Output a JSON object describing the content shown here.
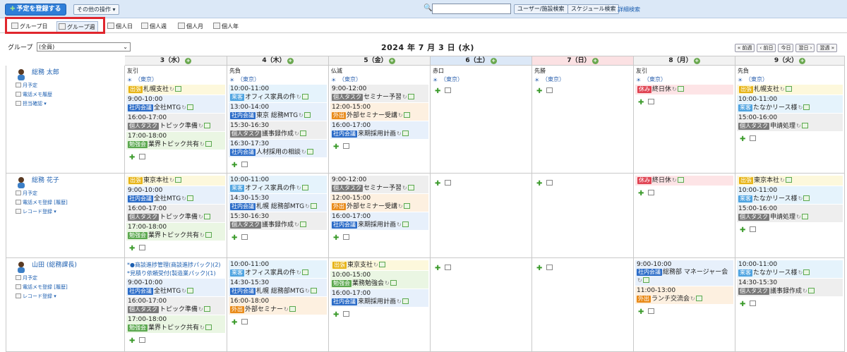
{
  "toolbar": {
    "register_label": "予定を登録する",
    "other_label": "その他の操作 ▾",
    "user_search": "ユーザー/施設検索",
    "schedule_search": "スケジュール検索",
    "detail_search": "詳細検索",
    "search_placeholder": ""
  },
  "tabs": [
    {
      "label": "グループ日"
    },
    {
      "label": "グループ週"
    },
    {
      "label": "個人日"
    },
    {
      "label": "個人週"
    },
    {
      "label": "個人月"
    },
    {
      "label": "個人年"
    }
  ],
  "group": {
    "label": "グループ",
    "selected": "(全員)"
  },
  "date_title": "2024 年 7 月 3 日 (水)",
  "nav": {
    "prev_week": "« 前週",
    "prev_day": "‹ 前日",
    "today": "今日",
    "next_day": "翌日 ›",
    "next_week": "翌週 »"
  },
  "days": [
    {
      "label": "3（水）",
      "rokuyo": "友引",
      "weather": "（東京）"
    },
    {
      "label": "4（木）",
      "rokuyo": "先負",
      "weather": "（東京）"
    },
    {
      "label": "5（金）",
      "rokuyo": "仏滅",
      "weather": "（東京）"
    },
    {
      "label": "6（土）",
      "rokuyo": "赤口",
      "weather": "（東京）"
    },
    {
      "label": "7（日）",
      "rokuyo": "先勝",
      "weather": "（東京）"
    },
    {
      "label": "8（月）",
      "rokuyo": "友引",
      "weather": "（東京）"
    },
    {
      "label": "9（火）",
      "rokuyo": "先負",
      "weather": "（東京）"
    }
  ],
  "users": [
    {
      "name": "総務 太郎",
      "links": [
        "月予定",
        "電話メモ履歴",
        "担当確認 ▾"
      ],
      "days": [
        [
          {
            "c": "yellow",
            "tag": "出張",
            "title": "札幌支社",
            "allday": true
          },
          {
            "c": "blue",
            "time": "9:00-10:00",
            "tag": "社内会議",
            "title": "全社MTG"
          },
          {
            "c": "gray",
            "time": "16:00-17:00",
            "tag": "個人タスク",
            "title": "トピック準備"
          },
          {
            "c": "green",
            "time": "17:00-18:00",
            "tag": "勉強会",
            "title": "業界トピック共有"
          }
        ],
        [
          {
            "c": "lblue",
            "time": "10:00-11:00",
            "tag": "来客",
            "title": "オフィス家具の件"
          },
          {
            "c": "blue",
            "time": "13:00-14:00",
            "tag": "社内会議",
            "title": "東京 総務MTG"
          },
          {
            "c": "gray",
            "time": "15:30-16:30",
            "tag": "個人タスク",
            "title": "議事録作成"
          },
          {
            "c": "blue",
            "time": "16:30-17:30",
            "tag": "社内会議",
            "title": "人材採用の相談"
          }
        ],
        [
          {
            "c": "gray",
            "time": "9:00-12:00",
            "tag": "個人タスク",
            "title": "セミナー予習"
          },
          {
            "c": "orange",
            "time": "12:00-15:00",
            "tag": "外出",
            "title": "外部セミナー受講"
          },
          {
            "c": "blue",
            "time": "16:00-17:00",
            "tag": "社内会議",
            "title": "来期採用計画"
          }
        ],
        [],
        [],
        [
          {
            "c": "red",
            "tag": "休み",
            "title": "終日休",
            "allday": true
          }
        ],
        [
          {
            "c": "yellow",
            "tag": "出張",
            "title": "札幌支社",
            "allday": true
          },
          {
            "c": "lblue",
            "time": "10:00-11:00",
            "tag": "来客",
            "title": "たなかリース様"
          },
          {
            "c": "gray",
            "time": "15:00-16:00",
            "tag": "個人タスク",
            "title": "申請処理"
          }
        ]
      ]
    },
    {
      "name": "総務 花子",
      "links": [
        "月予定",
        "電話メモ登録 [履歴]",
        "レコード登録 ▾"
      ],
      "days": [
        [
          {
            "c": "yellow",
            "tag": "出張",
            "title": "東京本社",
            "allday": true
          },
          {
            "c": "blue",
            "time": "9:00-10:00",
            "tag": "社内会議",
            "title": "全社MTG"
          },
          {
            "c": "gray",
            "time": "16:00-17:00",
            "tag": "個人タスク",
            "title": "トピック準備"
          },
          {
            "c": "green",
            "time": "17:00-18:00",
            "tag": "勉強会",
            "title": "業界トピック共有"
          }
        ],
        [
          {
            "c": "lblue",
            "time": "10:00-11:00",
            "tag": "来客",
            "title": "オフィス家具の件"
          },
          {
            "c": "blue",
            "time": "14:30-15:30",
            "tag": "社内会議",
            "title": "札幌 総務部MTG"
          },
          {
            "c": "gray",
            "time": "15:30-16:30",
            "tag": "個人タスク",
            "title": "議事録作成"
          }
        ],
        [
          {
            "c": "gray",
            "time": "9:00-12:00",
            "tag": "個人タスク",
            "title": "セミナー予習"
          },
          {
            "c": "orange",
            "time": "12:00-15:00",
            "tag": "外出",
            "title": "外部セミナー受講"
          },
          {
            "c": "blue",
            "time": "16:00-17:00",
            "tag": "社内会議",
            "title": "来期採用計画"
          }
        ],
        [],
        [],
        [
          {
            "c": "red",
            "tag": "休み",
            "title": "終日休",
            "allday": true
          }
        ],
        [
          {
            "c": "yellow",
            "tag": "出張",
            "title": "東京本社",
            "allday": true
          },
          {
            "c": "lblue",
            "time": "10:00-11:00",
            "tag": "来客",
            "title": "たなかリース様"
          },
          {
            "c": "gray",
            "time": "15:00-16:00",
            "tag": "個人タスク",
            "title": "申請処理"
          }
        ]
      ]
    },
    {
      "name": "山田 (総務課長)",
      "links": [
        "月予定",
        "電話メモ登録 [履歴]",
        "レコード登録 ▾"
      ],
      "pending": [
        "*●商談進捗管理(商談進捗パック)(2)",
        "*見積り依頼受付(製造業パック)(1)"
      ],
      "days": [
        [
          {
            "c": "blue",
            "time": "9:00-10:00",
            "tag": "社内会議",
            "title": "全社MTG"
          },
          {
            "c": "gray",
            "time": "16:00-17:00",
            "tag": "個人タスク",
            "title": "トピック準備"
          },
          {
            "c": "green",
            "time": "17:00-18:00",
            "tag": "勉強会",
            "title": "業界トピック共有"
          }
        ],
        [
          {
            "c": "lblue",
            "time": "10:00-11:00",
            "tag": "来客",
            "title": "オフィス家具の件"
          },
          {
            "c": "blue",
            "time": "14:30-15:30",
            "tag": "社内会議",
            "title": "札幌 総務部MTG"
          },
          {
            "c": "orange",
            "time": "16:00-18:00",
            "tag": "外出",
            "title": "外部セミナー"
          }
        ],
        [
          {
            "c": "yellow",
            "tag": "出張",
            "title": "東京支社",
            "allday": true
          },
          {
            "c": "green",
            "time": "10:00-15:00",
            "tag": "勉強会",
            "title": "業務勉強会"
          },
          {
            "c": "blue",
            "time": "16:00-17:00",
            "tag": "社内会議",
            "title": "来期採用計画"
          }
        ],
        [],
        [],
        [
          {
            "c": "blue",
            "time": "9:00-10:00",
            "tag": "社内会議",
            "title": "総務部 マネージャー会"
          },
          {
            "c": "orange",
            "time": "11:00-13:00",
            "tag": "外出",
            "title": "ランチ交流会"
          }
        ],
        [
          {
            "c": "lblue",
            "time": "10:00-11:00",
            "tag": "来客",
            "title": "たなかリース様"
          },
          {
            "c": "gray",
            "time": "14:30-15:30",
            "tag": "個人タスク",
            "title": "議事録作成"
          }
        ]
      ]
    }
  ]
}
